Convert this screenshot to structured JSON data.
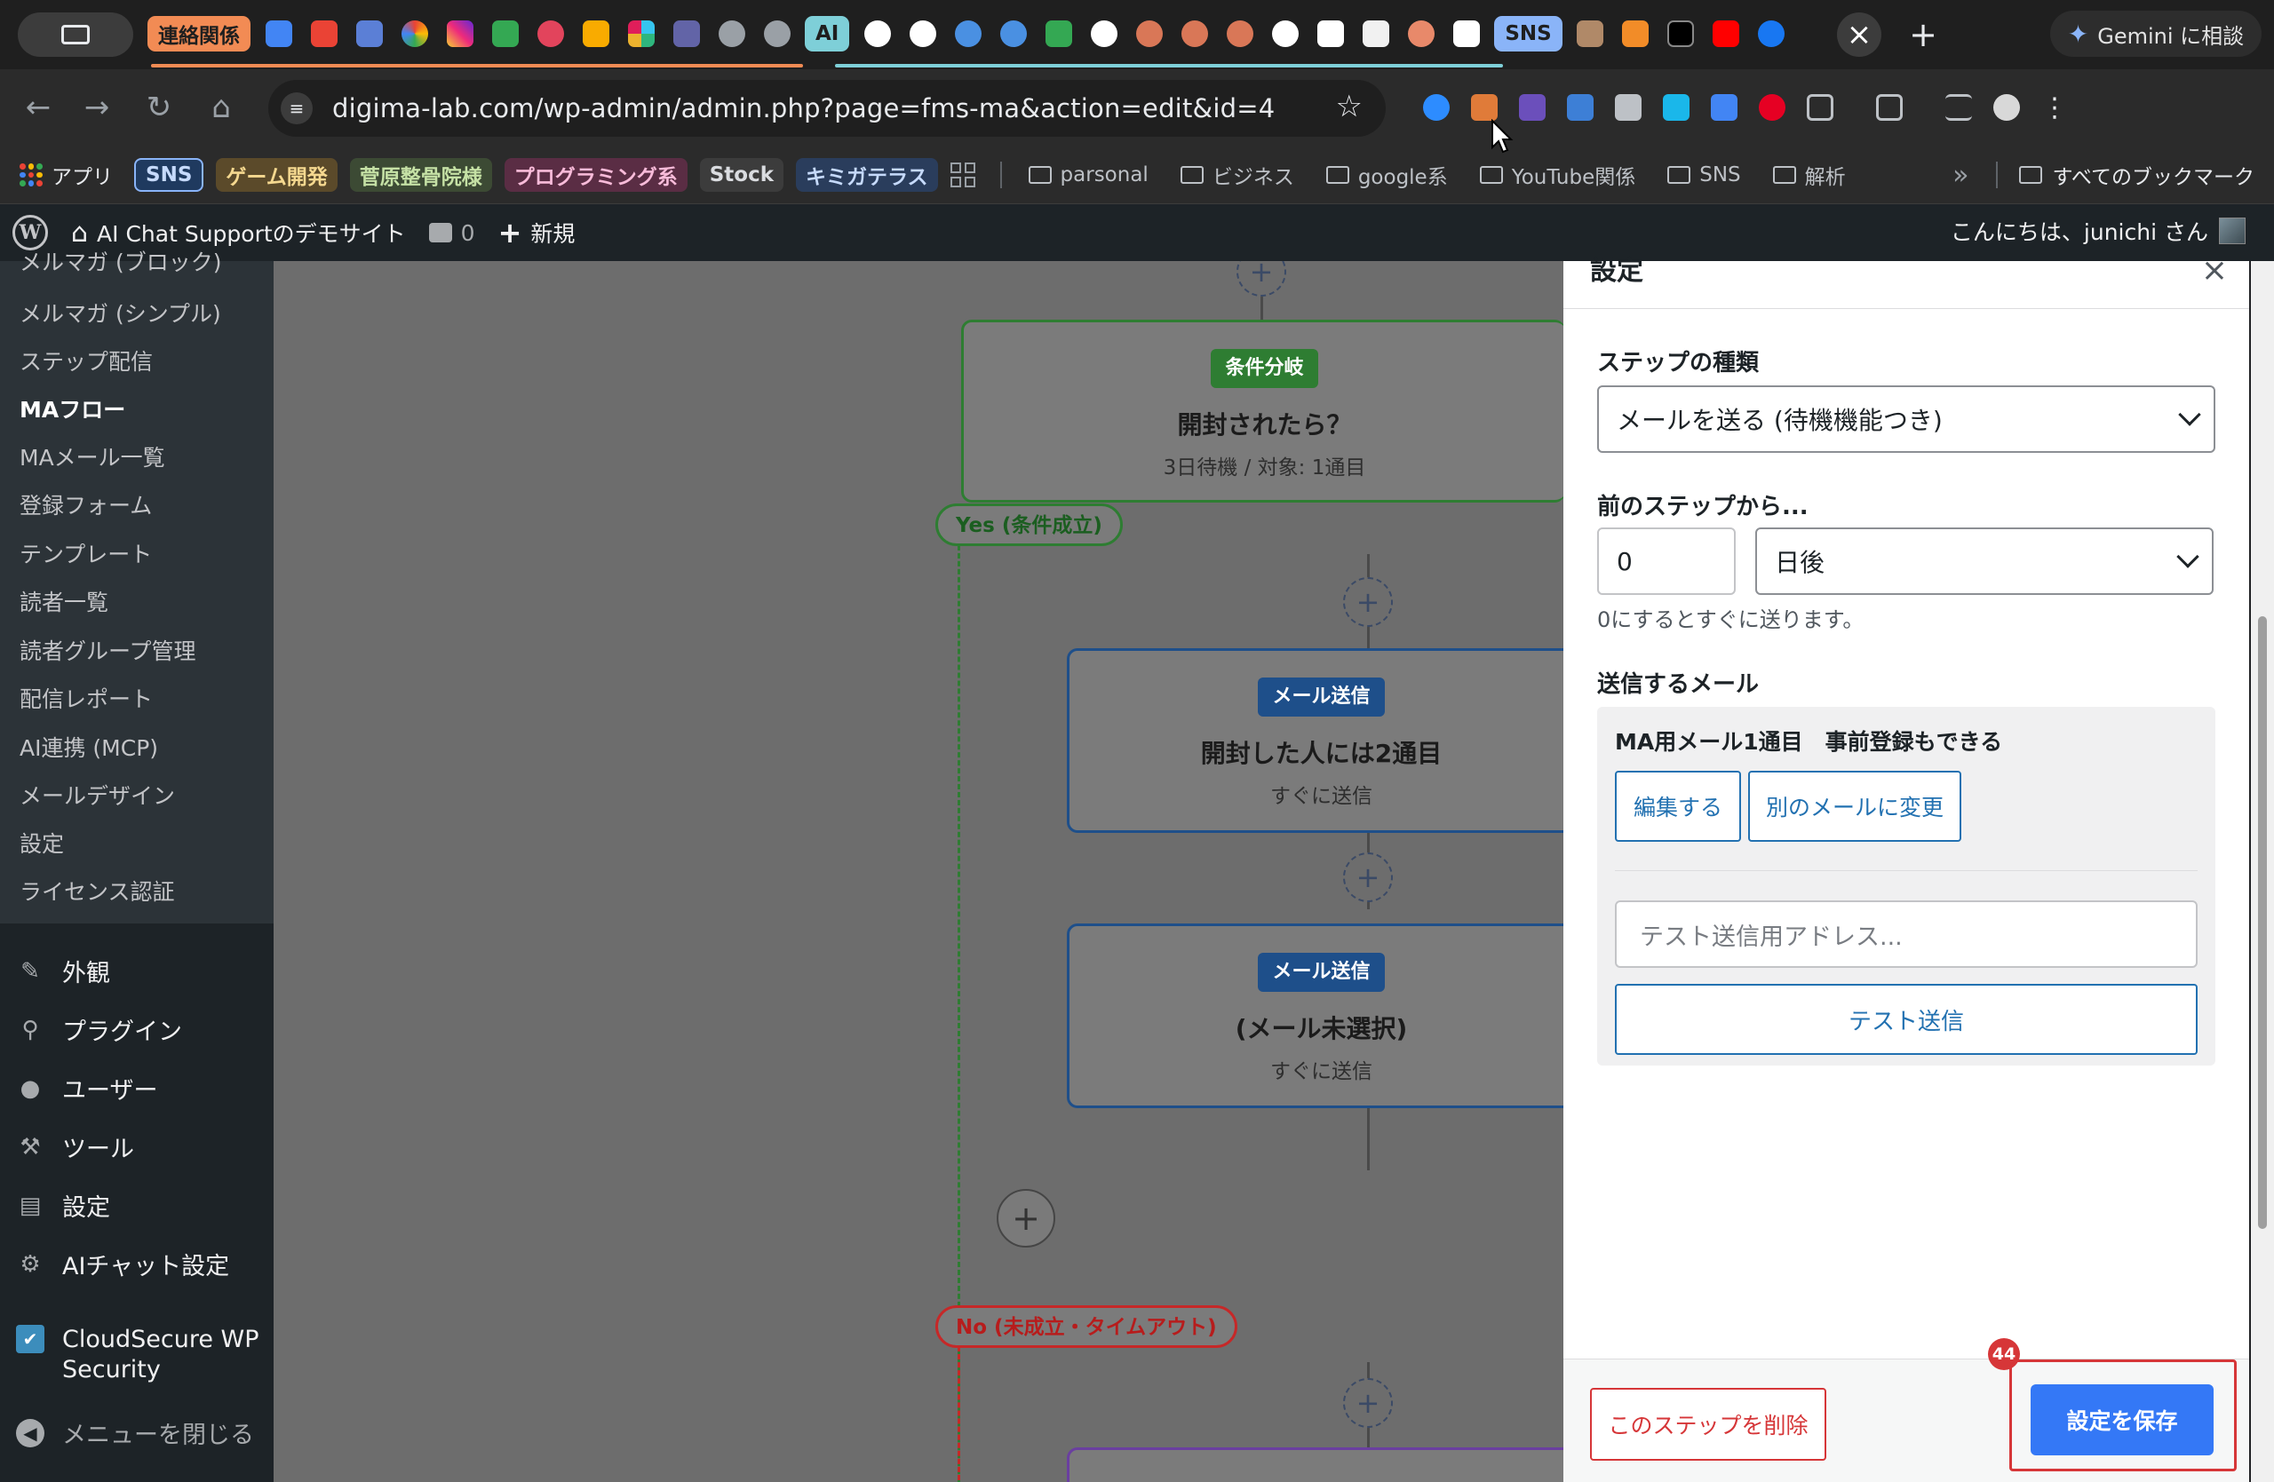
{
  "browser": {
    "tab_group_1": "連絡関係",
    "tab_group_ai": "AI",
    "tab_group_sns": "SNS",
    "tab_close": "×",
    "new_tab": "+",
    "gemini_label": "Gemini に相談",
    "url": "digima-lab.com/wp-admin/admin.php?page=fms-ma&action=edit&id=4",
    "back": "←",
    "forward": "→",
    "reload": "↻",
    "home": "⌂",
    "bookmark_star": "☆"
  },
  "bookmarks": {
    "apps": "アプリ",
    "labels": [
      "SNS",
      "ゲーム開発",
      "菅原整骨院様",
      "プログラミング系",
      "Stock",
      "キミガテラス"
    ],
    "folders": [
      "parsonal",
      "ビジネス",
      "google系",
      "YouTube関係",
      "SNS",
      "解析"
    ],
    "more": "»",
    "all_bookmarks": "すべてのブックマーク"
  },
  "wp_admin_bar": {
    "site_name": "AI Chat Supportのデモサイト",
    "comments_count": "0",
    "new_label": "新規",
    "howdy": "こんにちは、junichi さん"
  },
  "sidebar": {
    "submenu": [
      "メルマガ (ブロック)",
      "メルマガ (シンプル)",
      "ステップ配信",
      "MAフロー",
      "MAメール一覧",
      "登録フォーム",
      "テンプレート",
      "読者一覧",
      "読者グループ管理",
      "配信レポート",
      "AI連携 (MCP)",
      "メールデザイン",
      "設定",
      "ライセンス認証"
    ],
    "menu": [
      "外観",
      "プラグイン",
      "ユーザー",
      "ツール",
      "設定",
      "AIチャット設定",
      "CloudSecure WP Security",
      "メニューを閉じる"
    ]
  },
  "flow": {
    "condition_node": {
      "badge": "条件分岐",
      "title": "開封されたら？",
      "sub": "3日待機 / 対象: 1通目"
    },
    "yes_label": "Yes (条件成立)",
    "mail_node_1": {
      "badge": "メール送信",
      "title": "開封した人には2通目",
      "sub": "すぐに送信"
    },
    "mail_node_2": {
      "badge": "メール送信",
      "title": "(メール未選択)",
      "sub": "すぐに送信"
    },
    "no_label": "No (未成立・タイムアウト)",
    "plus": "+"
  },
  "panel": {
    "title": "設定",
    "close": "×",
    "step_type_label": "ステップの種類",
    "step_type_value": "メールを送る (待機機能つき)",
    "from_prev_label": "前のステップから...",
    "delay_value": "0",
    "delay_unit": "日後",
    "hint": "0にするとすぐに送ります。",
    "send_mail_label": "送信するメール",
    "mail_name": "MA用メール1通目　事前登録もできる",
    "edit_btn": "編集する",
    "change_btn": "別のメールに変更",
    "test_placeholder": "テスト送信用アドレス...",
    "test_send_btn": "テスト送信",
    "delete_btn": "このステップを削除",
    "save_btn": "設定を保存",
    "badge_count": "44"
  },
  "colors": {
    "wp_dark": "#1d2327",
    "wp_blue": "#2271b1",
    "save_blue": "#3478f6",
    "danger": "#d63638",
    "condition_green": "#2e7d32",
    "mail_blue": "#1e4f8a"
  }
}
